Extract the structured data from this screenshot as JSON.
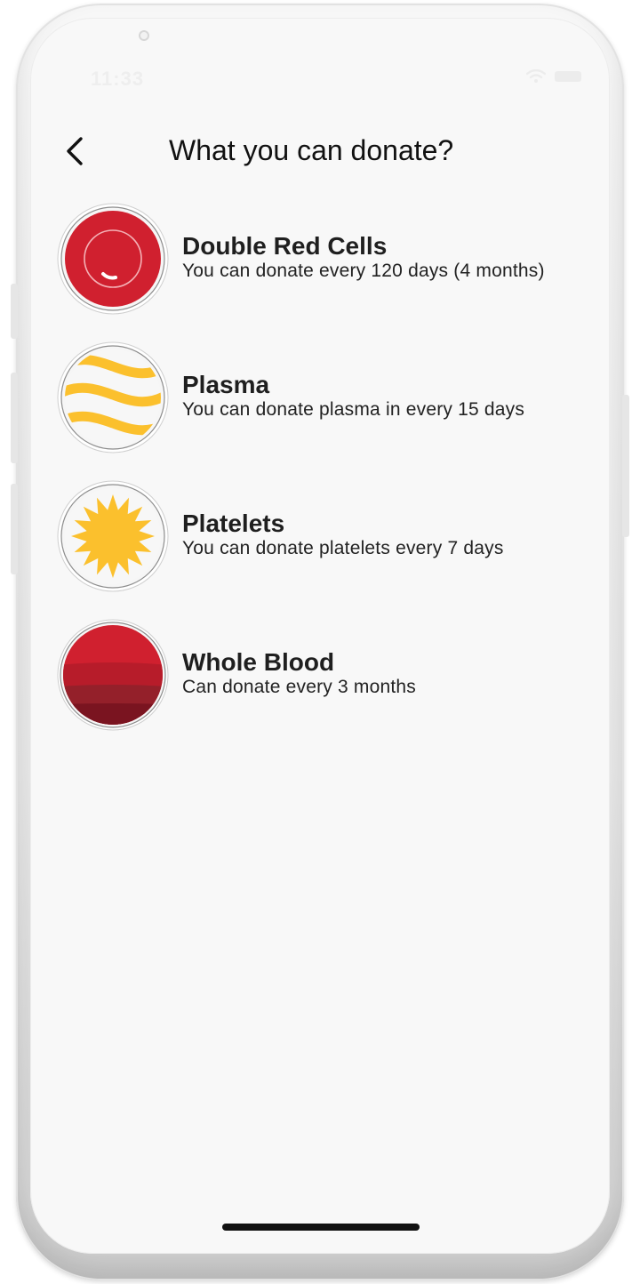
{
  "status_bar": {
    "time": "11:33",
    "wifi_icon": "wifi-icon",
    "battery_icon": "battery-icon"
  },
  "header": {
    "back_icon": "chevron-left-icon",
    "title": "What you can donate?"
  },
  "donation_types": [
    {
      "title": "Double Red Cells",
      "subtitle": "You can donate every 120 days (4 months)",
      "icon": "red-cell-icon",
      "color": "#d0202f"
    },
    {
      "title": "Plasma",
      "subtitle": "You can donate plasma in every 15 days",
      "icon": "plasma-waves-icon",
      "color": "#fbc02d"
    },
    {
      "title": "Platelets",
      "subtitle": "You can donate platelets every 7 days",
      "icon": "platelet-star-icon",
      "color": "#fbc02d"
    },
    {
      "title": "Whole Blood",
      "subtitle": "Can donate every 3 months",
      "icon": "whole-blood-icon",
      "color": "#b71c2a"
    }
  ],
  "colors": {
    "background": "#f8f8f8",
    "text_primary": "#1f1f1f",
    "blood_red": "#d0202f",
    "plasma_yellow": "#fbc02d"
  }
}
